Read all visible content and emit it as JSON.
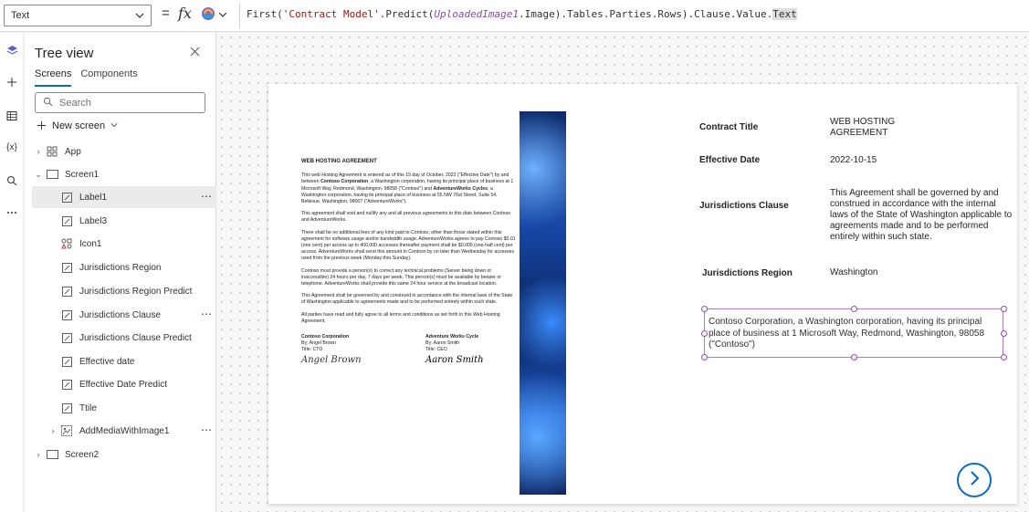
{
  "formula_bar": {
    "property": "Text",
    "equals": "=",
    "fx": "fx",
    "formula": {
      "part1": "First(",
      "part2": "'Contract Model'",
      "part3": ".Predict(",
      "part4": "UploadedImage1",
      "part5": ".Image).Tables.Parties.Rows).Clause.Value.",
      "part6": "Text"
    }
  },
  "rail": {
    "icons": [
      "layers-icon",
      "plus-icon",
      "table-icon",
      "variables-icon",
      "search-icon",
      "more-icon"
    ],
    "variables_glyph": "{x}"
  },
  "tree_view": {
    "title": "Tree view",
    "tabs": [
      "Screens",
      "Components"
    ],
    "search_placeholder": "Search",
    "new_screen": "New screen",
    "items": [
      {
        "label": "App"
      },
      {
        "label": "Screen1"
      },
      {
        "label": "Label1"
      },
      {
        "label": "Label3"
      },
      {
        "label": "Icon1"
      },
      {
        "label": "Jurisdictions Region"
      },
      {
        "label": "Jurisdictions Region Predict"
      },
      {
        "label": "Jurisdictions Clause"
      },
      {
        "label": "Jurisdictions Clause Predict"
      },
      {
        "label": "Effective date"
      },
      {
        "label": "Effective Date Predict"
      },
      {
        "label": "Ttile"
      },
      {
        "label": "AddMediaWithImage1"
      },
      {
        "label": "Screen2"
      }
    ]
  },
  "document": {
    "title": "WEB HOSTING AGREEMENT",
    "p1_a": "This web Hosting Agreement is entered as of this 15 day of October, 2022 (\"Effective Date\") by and between ",
    "p1_b": "Contoso Corporation",
    "p1_c": ", a Washington corporation, having its principal place of business at 1 Microsoft Way, Redmond, Washington, 98058 (\"Contoso\") and ",
    "p1_d": "AdventureWorks Cycles",
    "p1_e": ", a Washington corporation, having its principal place of business at 55 NW 76st Street, Suite 54, Bellevue, Washington, 98007 (\"AdventureWorks\").",
    "p2": "This agreement shall void and nullify any and all previous agreements to this date between Contoso and AdventureWorks.",
    "p3": "There shall be no additional fees of any kind paid to Contoso, other than those stated within this agreement for software usage and/or bandwidth usage. AdventureWorks agrees to pay Contoso $0.01 (one cent) per access up to 400,000 accesses thereafter payment shall be $0.005 (one-half cent) per access. AdventureWorks shall send this amount to Contoso by no later than Wednesday for accesses used from the previous week (Monday thru Sunday).",
    "p4": "Contoso must provide a person(s) to correct any technical problems (Server being down or inaccessible) 24 hours per day, 7 days per week. This person(s) must be available by beeper or telephone. AdventureWorks shall provide this same 24 hour service at the broadcast location.",
    "p5": "This Agreement shall be governed by and construed in accordance with the internal laws of the State of Washington applicable to agreements made and to be performed entirely within such state.",
    "p6": "All parties have read and fully agree to all terms and conditions as set forth in this Web Hosting Agreement.",
    "sig_left": {
      "org": "Contoso Corporation",
      "by": "By: Angel Brown",
      "title": "Title: CTO",
      "signature": "Angel Brown"
    },
    "sig_right": {
      "org": "Adventure Works Cycle",
      "by": "By: Aaron Smith",
      "title": "Title: CEO",
      "signature": "Aaron Smith"
    }
  },
  "fields": {
    "contract_title_label": "Contract Title",
    "contract_title_value_1": "WEB HOSTING",
    "contract_title_value_2": "AGREEMENT",
    "effective_date_label": "Effective Date",
    "effective_date_value": "2022-10-15",
    "jurisdictions_clause_label": "Jurisdictions Clause",
    "jurisdictions_clause_value": "This Agreement shall be governed by and construed in accordance with the internal laws of the State of Washington applicable to agreements made and to be performed entirely within such state.",
    "jurisdictions_region_label": "Jurisdictions Region",
    "jurisdictions_region_value": "Washington",
    "selected_label_text": "Contoso Corporation, a Washington corporation, having its principal place of business at 1 Microsoft Way, Redmond, Washington, 98058 (\"Contoso\")"
  },
  "colors": {
    "accent": "#0f6cbd",
    "selection": "#8a4ea8"
  }
}
